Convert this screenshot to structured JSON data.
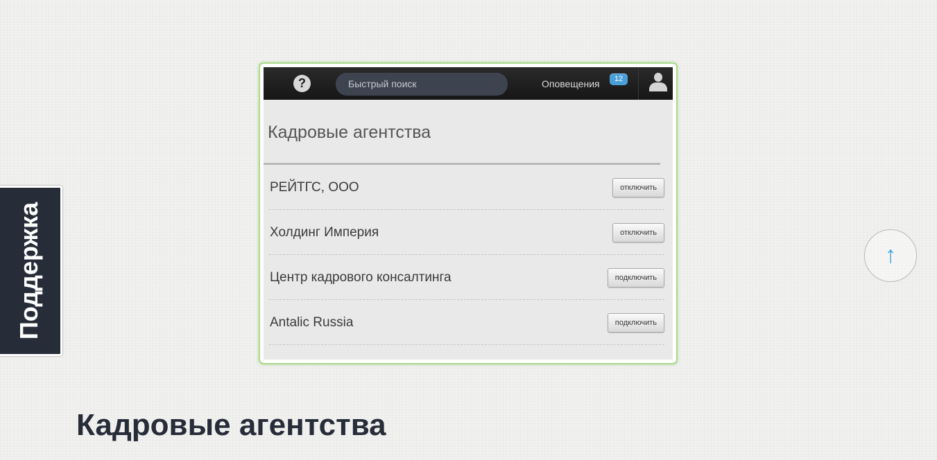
{
  "screenshot": {
    "topbar": {
      "help_icon": "?",
      "search_placeholder": "Быстрый поиск",
      "notifications_label": "Оповещения",
      "notifications_count": "12"
    },
    "title": "Кадровые агентства",
    "agencies": [
      {
        "name": "РЕЙТГС, ООО",
        "action": "отключить"
      },
      {
        "name": "Холдинг Империя",
        "action": "отключить"
      },
      {
        "name": "Центр кадрового консалтинга",
        "action": "подключить"
      },
      {
        "name": "Antalic Russia",
        "action": "подключить"
      }
    ]
  },
  "support_tab": {
    "label": "Поддержка"
  },
  "scroll_top": {
    "icon": "↑"
  },
  "page": {
    "title": "Кадровые агентства"
  },
  "colors": {
    "frame_border": "#a9d98a",
    "topbar_bg": "#1e1e1e",
    "badge_blue": "#4a9fd8",
    "support_bg": "#262c38",
    "arrow_blue": "#49a8e0"
  }
}
